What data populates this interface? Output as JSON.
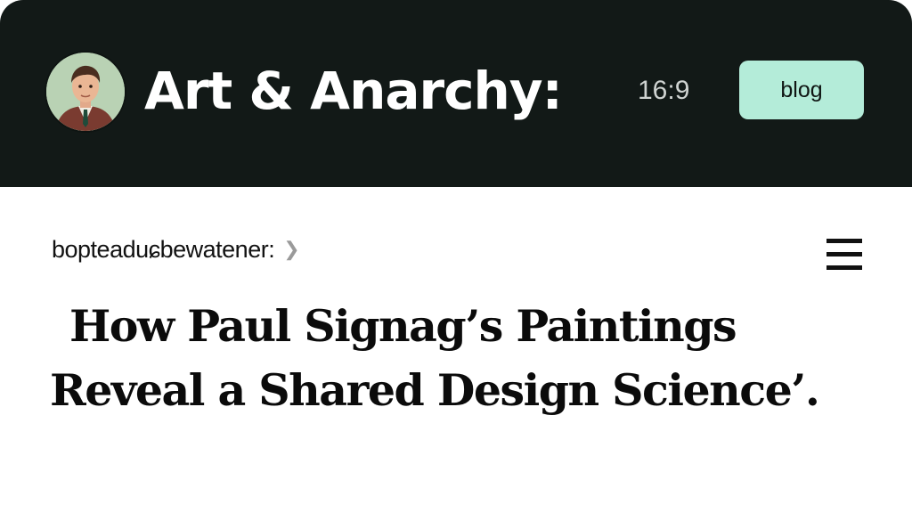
{
  "header": {
    "site_title": "Art & Anarchy:",
    "ratio_label": "16:9",
    "blog_button": "blog",
    "avatar_icon": "portrait-avatar-icon",
    "colors": {
      "header_bg": "#121917",
      "button_bg": "#b4ecd9"
    }
  },
  "nav": {
    "breadcrumb": "bopteaduɕbewatener:",
    "chevron_icon": "chevron-right-icon",
    "menu_icon": "hamburger-menu-icon"
  },
  "article": {
    "headline_line1": "How Paul Signag’s Paintings",
    "headline_line2": "Reveal a Shared Design Science’."
  }
}
